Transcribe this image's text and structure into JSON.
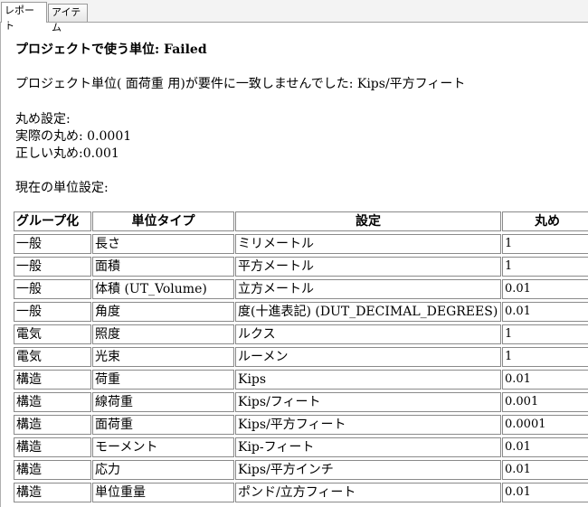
{
  "tabs": [
    "レポート",
    "アイテム"
  ],
  "report": {
    "title": "プロジェクトで使う単位: Failed",
    "message": "プロジェクト単位( 面荷重 用)が要件に一致しませんでした: Kips/平方フィート",
    "rounding_heading": "丸め設定:",
    "actual_rounding": "実際の丸め: 0.0001",
    "correct_rounding": "正しい丸め:0.001",
    "current_settings": "現在の単位設定:"
  },
  "table": {
    "headers": [
      "グループ化",
      "単位タイプ",
      "設定",
      "丸め"
    ],
    "rows": [
      [
        "一般",
        "長さ",
        "ミリメートル",
        "1"
      ],
      [
        "一般",
        "面積",
        "平方メートル",
        "1"
      ],
      [
        "一般",
        "体積 (UT_Volume)",
        "立方メートル",
        "0.01"
      ],
      [
        "一般",
        "角度",
        "度(十進表記) (DUT_DECIMAL_DEGREES)",
        "0.01"
      ],
      [
        "電気",
        "照度",
        "ルクス",
        "1"
      ],
      [
        "電気",
        "光束",
        "ルーメン",
        "1"
      ],
      [
        "構造",
        "荷重",
        "Kips",
        "0.01"
      ],
      [
        "構造",
        "線荷重",
        "Kips/フィート",
        "0.001"
      ],
      [
        "構造",
        "面荷重",
        "Kips/平方フィート",
        "0.0001"
      ],
      [
        "構造",
        "モーメント",
        "Kip-フィート",
        "0.01"
      ],
      [
        "構造",
        "応力",
        "Kips/平方インチ",
        "0.01"
      ],
      [
        "構造",
        "単位重量",
        "ポンド/立方フィート",
        "0.01"
      ]
    ]
  }
}
